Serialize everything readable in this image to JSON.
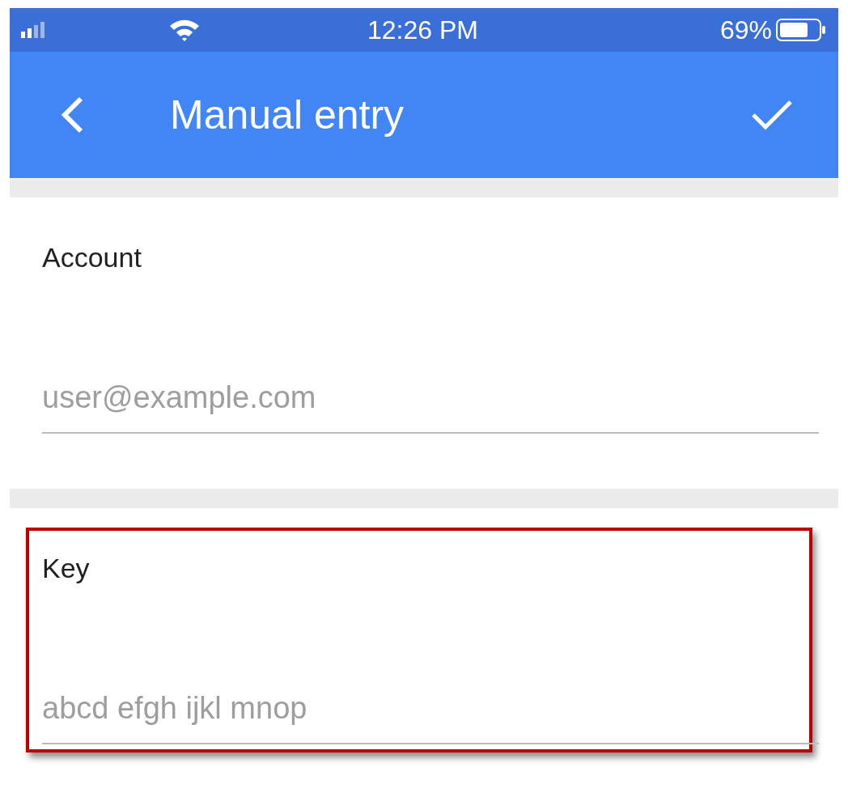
{
  "status_bar": {
    "time": "12:26 PM",
    "battery": "69%"
  },
  "app_bar": {
    "title": "Manual entry"
  },
  "fields": [
    {
      "label": "Account",
      "placeholder": "user@example.com",
      "highlighted": false
    },
    {
      "label": "Key",
      "placeholder": "abcd efgh ijkl mnop",
      "highlighted": true
    }
  ]
}
